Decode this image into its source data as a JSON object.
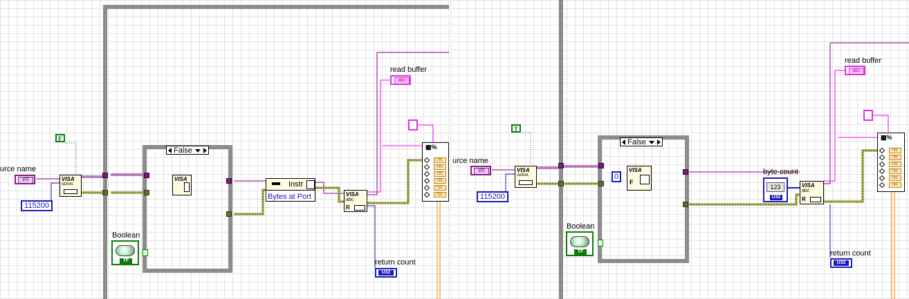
{
  "left": {
    "labels": {
      "resource_name": "urce name",
      "read_buffer": "read buffer",
      "boolean": "Boolean",
      "return_count": "return count"
    },
    "baud_rate": "115200",
    "bool_const": "F",
    "case_selector": "False",
    "property_node": {
      "class": "Instr",
      "property": "Bytes at Port"
    },
    "visa_serial_title": "VISA",
    "visa_serial_sub": "SERIAL",
    "visa_read_title": "VISA",
    "visa_read_sub": "abc",
    "io_tag": "I/O",
    "str_tag": "abc",
    "u32_tag": "U32",
    "tf_tag": "TF"
  },
  "right": {
    "labels": {
      "resource_name": "urce name",
      "read_buffer": "read buffer",
      "boolean": "Boolean",
      "return_count": "return count",
      "byte_count": "byte count"
    },
    "baud_rate": "115200",
    "bool_const": "T",
    "case_selector": "False",
    "zero_const": "0",
    "byte_count_value": "123",
    "visa_serial_title": "VISA",
    "visa_serial_sub": "SERIAL",
    "visa_read_title": "VISA",
    "visa_read_sub": "abc",
    "io_tag": "I/O",
    "str_tag": "abc",
    "u32_tag": "U32",
    "tf_tag": "TF"
  },
  "colors": {
    "visa_wire": "#800080",
    "error_wire": "#7d7d1a",
    "string_wire": "#ff00ff",
    "numeric_wire": "#0000cc",
    "boolean_wire": "#009900",
    "structure": "#8c8c8c",
    "format_wire": "#ff8000"
  }
}
